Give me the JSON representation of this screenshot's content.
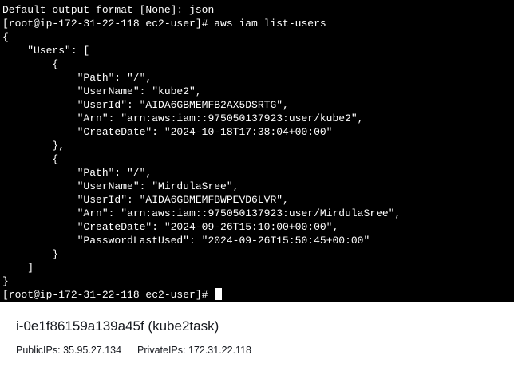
{
  "terminal": {
    "lines": [
      "Default output format [None]: json",
      "[root@ip-172-31-22-118 ec2-user]# aws iam list-users",
      "{",
      "    \"Users\": [",
      "        {",
      "            \"Path\": \"/\",",
      "            \"UserName\": \"kube2\",",
      "            \"UserId\": \"AIDA6GBMEMFB2AX5DSRTG\",",
      "            \"Arn\": \"arn:aws:iam::975050137923:user/kube2\",",
      "            \"CreateDate\": \"2024-10-18T17:38:04+00:00\"",
      "        },",
      "        {",
      "            \"Path\": \"/\",",
      "            \"UserName\": \"MirdulaSree\",",
      "            \"UserId\": \"AIDA6GBMEMFBWPEVD6LVR\",",
      "            \"Arn\": \"arn:aws:iam::975050137923:user/MirdulaSree\",",
      "            \"CreateDate\": \"2024-09-26T15:10:00+00:00\",",
      "            \"PasswordLastUsed\": \"2024-09-26T15:50:45+00:00\"",
      "        }",
      "    ]",
      "}"
    ],
    "prompt": "[root@ip-172-31-22-118 ec2-user]# "
  },
  "instance": {
    "title": "i-0e1f86159a139a45f (kube2task)",
    "public_ips_label": "PublicIPs:",
    "public_ips_value": "35.95.27.134",
    "private_ips_label": "PrivateIPs:",
    "private_ips_value": "172.31.22.118"
  },
  "colors": {
    "terminal_bg": "#000000",
    "terminal_fg": "#ffffff",
    "panel_bg": "#ffffff",
    "panel_text": "#16191f"
  }
}
